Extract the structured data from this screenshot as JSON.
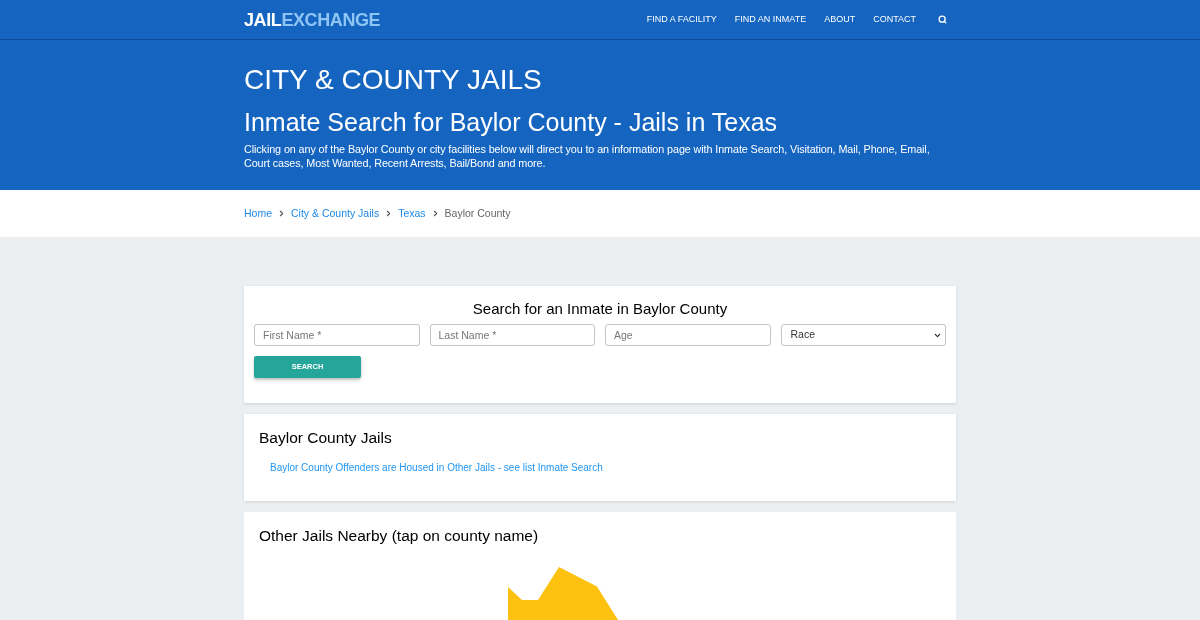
{
  "header": {
    "logo": {
      "first": "JAIL",
      "second": "EXCHANGE"
    },
    "nav": [
      "FIND A FACILITY",
      "FIND AN INMATE",
      "ABOUT",
      "CONTACT"
    ]
  },
  "hero": {
    "title": "CITY & COUNTY JAILS",
    "subtitle": "Inmate Search for Baylor County - Jails in Texas",
    "description": "Clicking on any of the Baylor County or city facilities below will direct you to an information page with Inmate Search, Visitation, Mail, Phone, Email, Court cases, Most Wanted, Recent Arrests, Bail/Bond and more."
  },
  "breadcrumb": [
    {
      "label": "Home",
      "kind": "link"
    },
    {
      "label": "City & County Jails",
      "kind": "link"
    },
    {
      "label": "Texas",
      "kind": "link"
    },
    {
      "label": "Baylor County",
      "kind": "current"
    }
  ],
  "search_card": {
    "title": "Search for an Inmate in Baylor County",
    "fields": [
      {
        "kind": "text",
        "placeholder": "First Name *"
      },
      {
        "kind": "text",
        "placeholder": "Last Name *"
      },
      {
        "kind": "text",
        "placeholder": "Age"
      },
      {
        "kind": "select",
        "value": "Race"
      }
    ],
    "button": "SEARCH"
  },
  "jails_card": {
    "title": "Baylor County Jails",
    "links": [
      "Baylor County Offenders are Housed in Other Jails - see list Inmate Search"
    ]
  },
  "nearby_card": {
    "title": "Other Jails Nearby (tap on county name)"
  }
}
